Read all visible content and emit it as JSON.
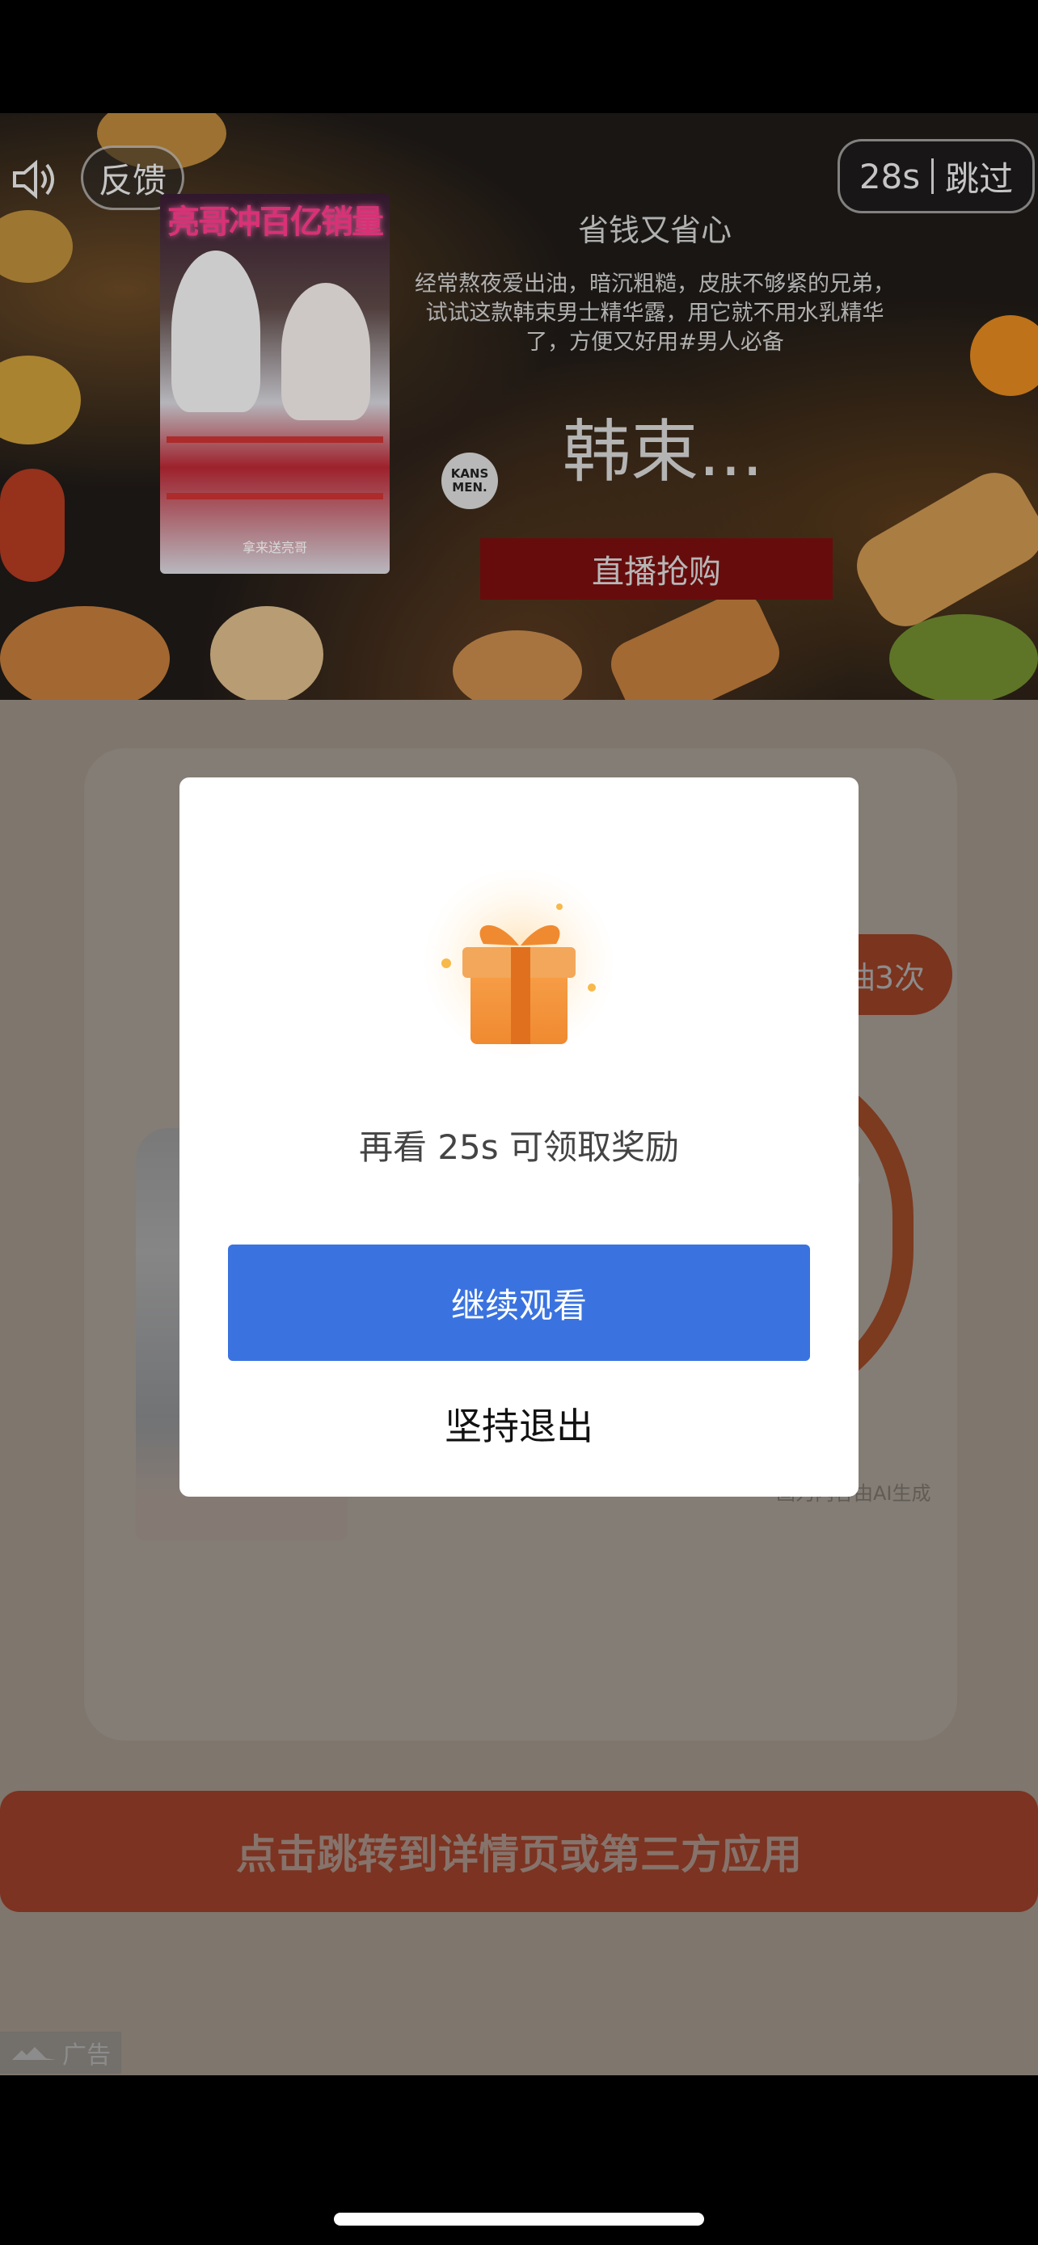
{
  "video_ad": {
    "feedback_label": "反馈",
    "countdown": "28s",
    "skip_label": "跳过",
    "thumbnail_title": "亮哥冲百亿销量",
    "thumbnail_caption": "拿来送亮哥",
    "headline": "省钱又省心",
    "description": "经常熬夜爱出油，暗沉粗糙，皮肤不够紧的兄弟，试试这款韩束男士精华露，用它就不用水乳精华了，方便又好用#男人必备",
    "brand_logo_text": "KANS MEN.",
    "brand_name": "韩束...",
    "cta_label": "直播抢购"
  },
  "background_page": {
    "lottery_badge": "抽3次",
    "ai_note": "画为内容由AI生成",
    "jump_cta": "点击跳转到详情页或第三方应用",
    "ad_tag": "广告"
  },
  "dialog": {
    "reward_text": "再看 25s 可领取奖励",
    "continue_label": "继续观看",
    "exit_label": "坚持退出"
  },
  "colors": {
    "continue_button": "#3a73e0",
    "jump_button": "#e25d3c",
    "cta_button": "#7a0f0f"
  }
}
